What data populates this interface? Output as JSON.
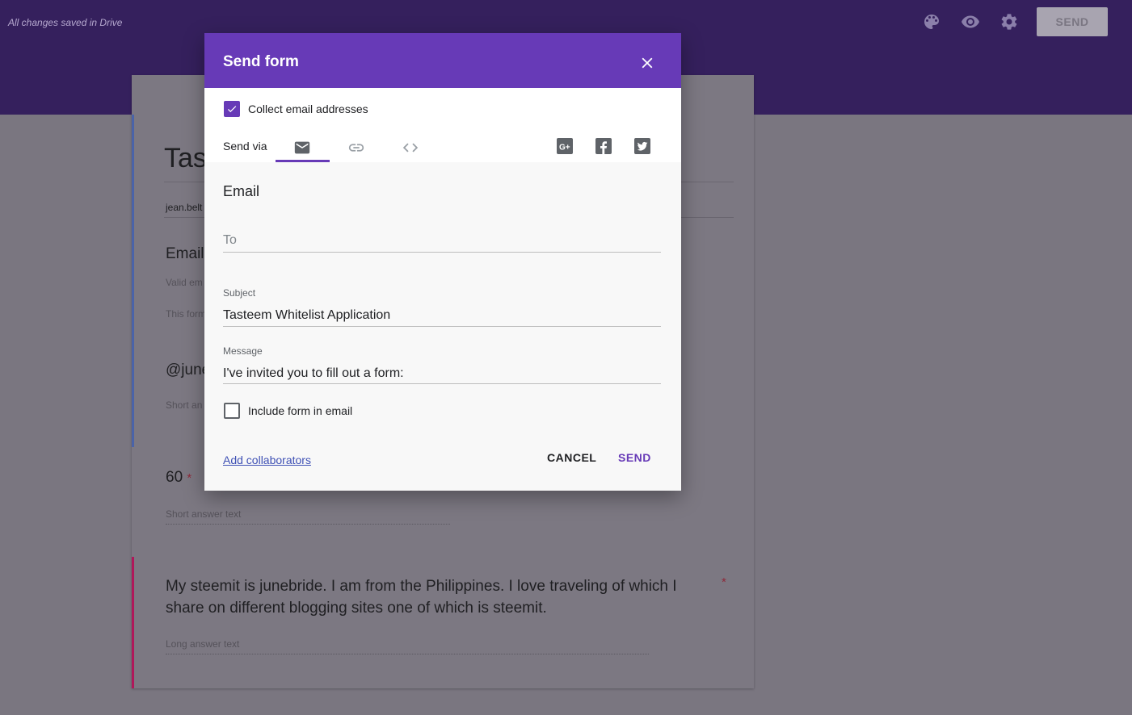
{
  "app": {
    "saved_status": "All changes saved in Drive",
    "toolbar": {
      "icons": [
        "palette-icon",
        "eye-icon",
        "gear-icon"
      ],
      "send_label": "SEND"
    }
  },
  "form": {
    "title_partial": "Tas",
    "email_partial": "jean.belt",
    "q1_title_partial": "Email",
    "q1_hint_partial": "Valid em",
    "q1_note_partial": "This form",
    "q2_title_partial": "@june",
    "q2_hint_partial": "Short an",
    "q3_title": "60",
    "q3_required": "*",
    "q3_hint": "Short answer text",
    "q4_title": "My steemit is junebride. I am from the Philippines. I love traveling of which I share on different blogging sites one of which is steemit.",
    "q4_required": "*",
    "q4_hint": "Long answer text"
  },
  "dialog": {
    "title": "Send form",
    "collect_email_label": "Collect email addresses",
    "collect_email_checked": true,
    "send_via_label": "Send via",
    "via_tabs": [
      "email-icon",
      "link-icon",
      "embed-icon"
    ],
    "selected_tab": "email-icon",
    "social": [
      "google-plus-icon",
      "facebook-icon",
      "twitter-icon"
    ],
    "section_heading": "Email",
    "to_placeholder": "To",
    "to_value": "",
    "subject_label": "Subject",
    "subject_value": "Tasteem Whitelist Application",
    "message_label": "Message",
    "message_value": "I've invited you to fill out a form:",
    "include_form_label": "Include form in email",
    "include_form_checked": false,
    "add_collaborators_label": "Add collaborators",
    "cancel_label": "CANCEL",
    "send_label": "SEND",
    "accent_color": "#673ab7"
  }
}
